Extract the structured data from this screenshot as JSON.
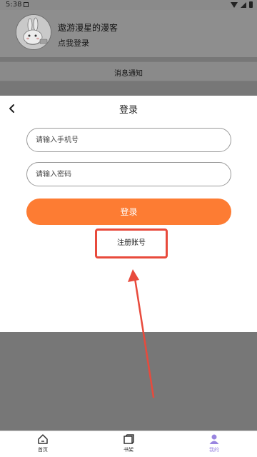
{
  "status_bar": {
    "time": "5:38"
  },
  "profile": {
    "nickname": "遨游漫星的漫客",
    "login_prompt": "点我登录"
  },
  "notice": {
    "label": "消息通知"
  },
  "login_sheet": {
    "title": "登录",
    "phone_placeholder": "请输入手机号",
    "password_placeholder": "请输入密码",
    "login_button": "登录",
    "register_link": "注册账号"
  },
  "annotation": {
    "color": "#e84a3c"
  },
  "tabbar": {
    "items": [
      {
        "label": "首页",
        "icon": "home-icon"
      },
      {
        "label": "书架",
        "icon": "bookshelf-icon"
      },
      {
        "label": "我的",
        "icon": "profile-icon",
        "active": true
      }
    ],
    "active_color": "#9a85e0"
  },
  "colors": {
    "accent": "#fd7c33"
  }
}
